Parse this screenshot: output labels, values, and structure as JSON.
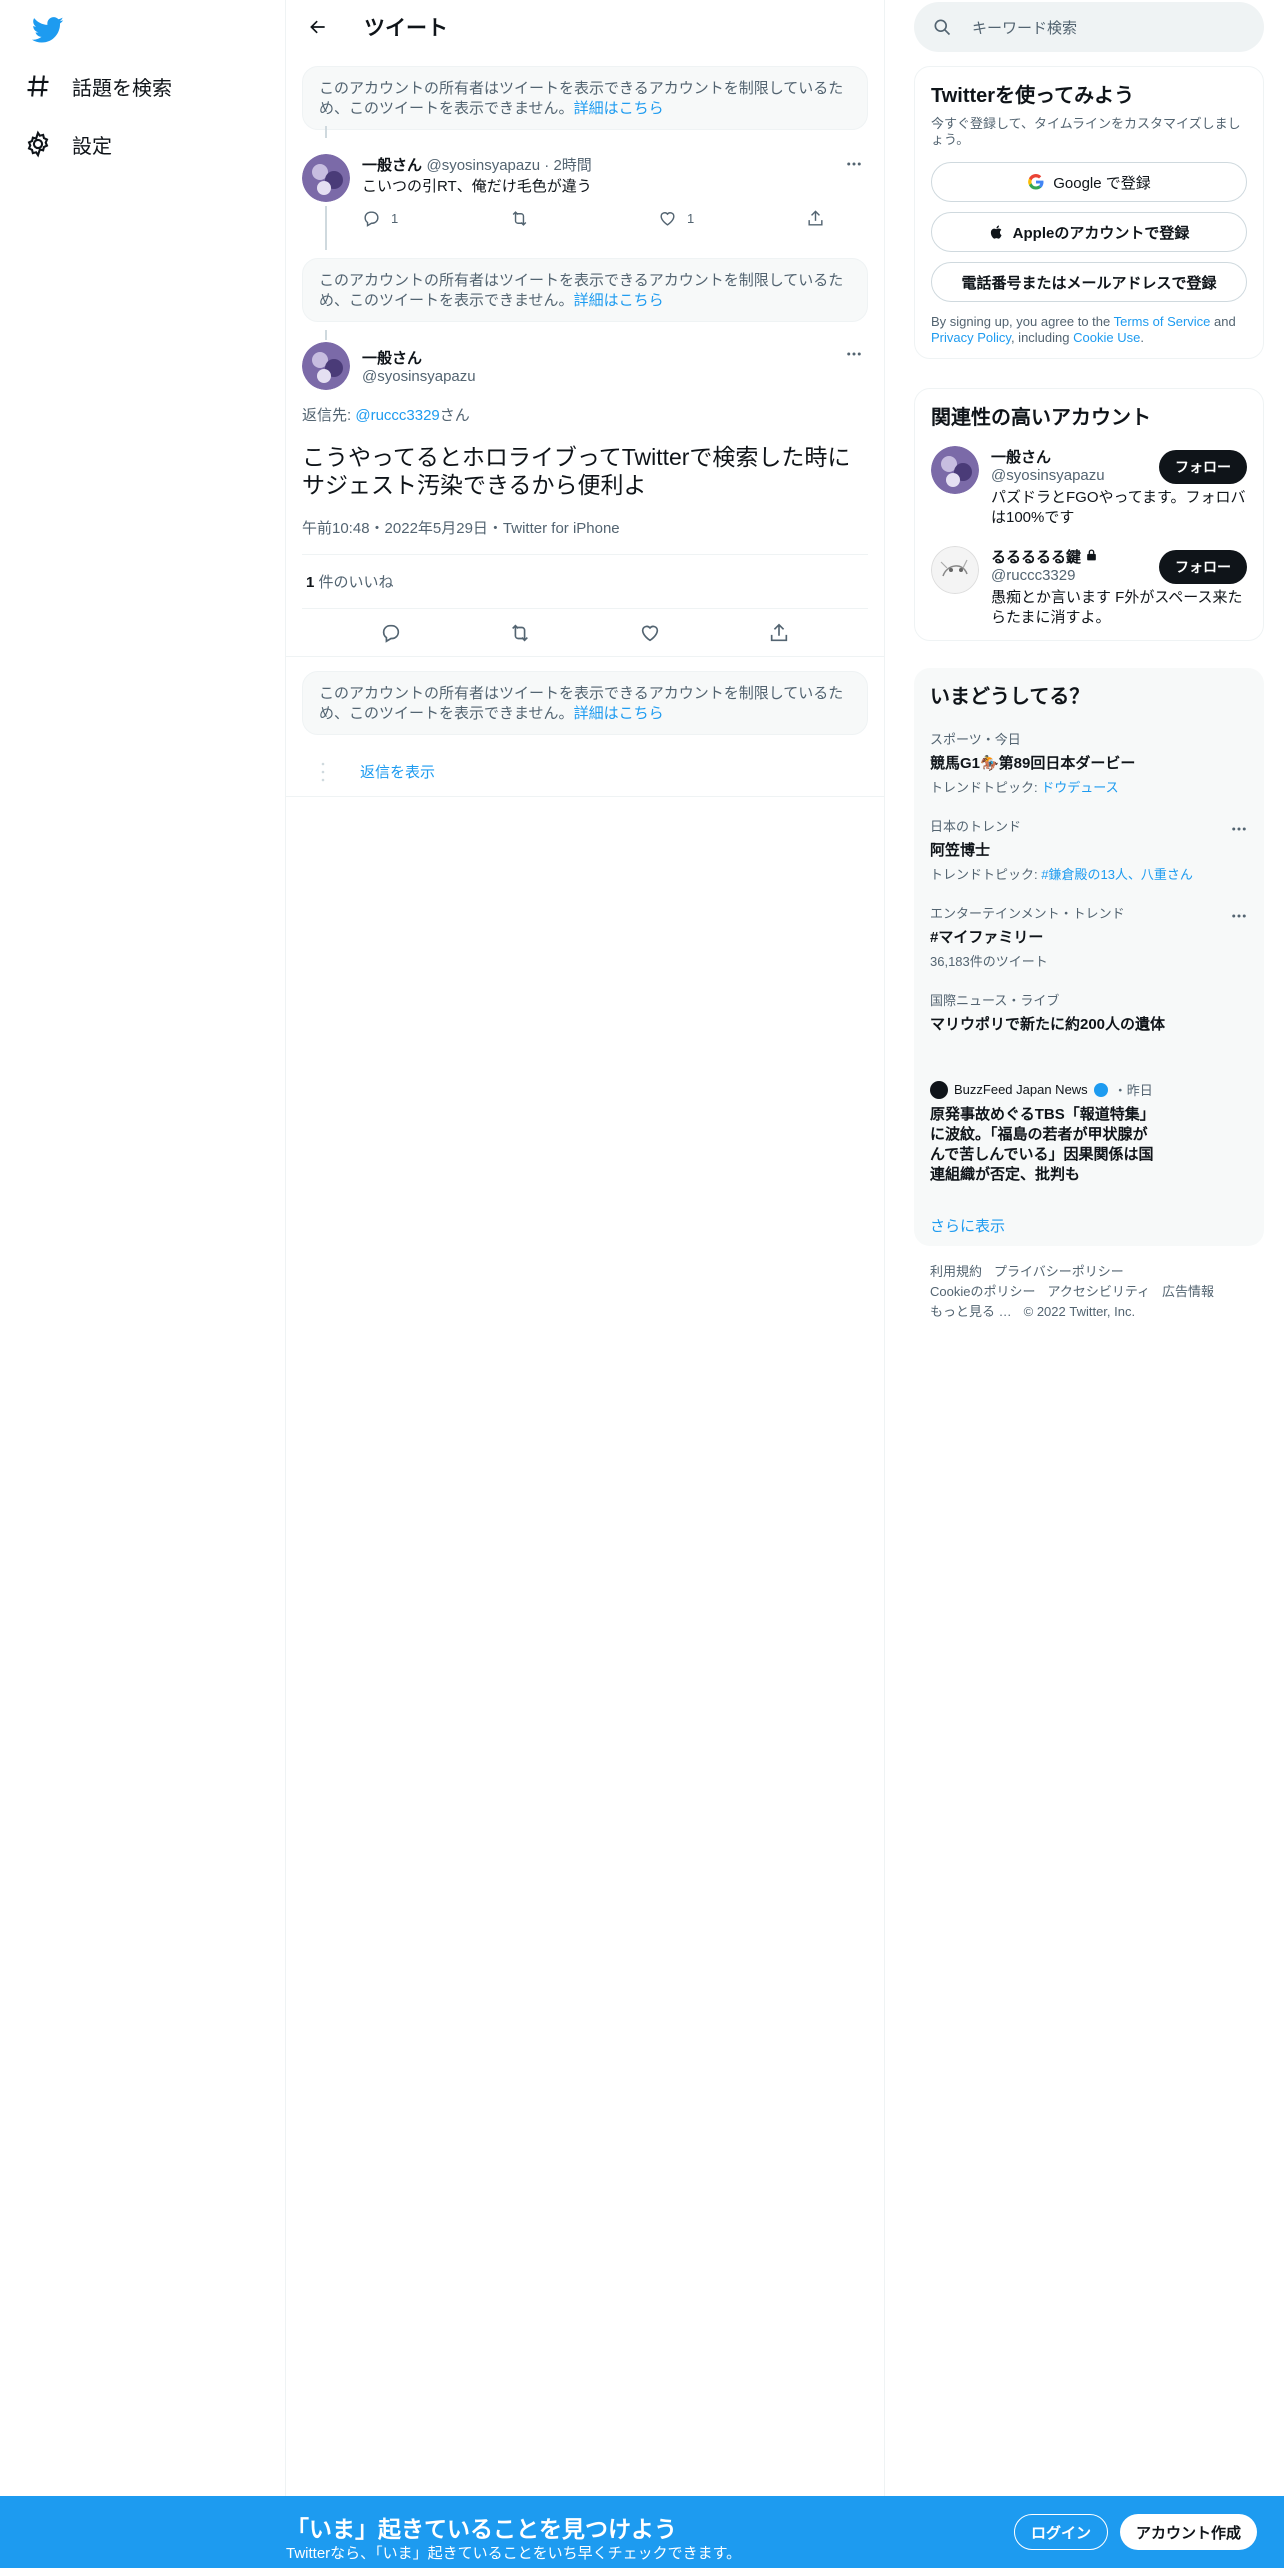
{
  "sidebar": {
    "items": [
      {
        "label": "話題を検索"
      },
      {
        "label": "設定"
      }
    ]
  },
  "header": {
    "title": "ツイート"
  },
  "notices": {
    "text": "このアカウントの所有者はツイートを表示できるアカウントを制限しているため、このツイートを表示できません。",
    "link": "詳細はこちら"
  },
  "reply_tweet": {
    "name": "一般さん",
    "handle": "@syosinsyapazu",
    "time": "2時間",
    "text": "こいつの引RT、俺だけ毛色が違う",
    "reply_count": "1",
    "like_count": "1"
  },
  "focus_tweet": {
    "name": "一般さん",
    "handle": "@syosinsyapazu",
    "reply_to_label": "返信先: ",
    "reply_to_handle": "@ruccc3329",
    "reply_to_suffix": "さん",
    "text": "こうやってるとホロライブってTwitterで検索した時にサジェスト汚染できるから便利よ",
    "meta": "午前10:48・2022年5月29日・Twitter for iPhone",
    "likes_count": "1",
    "likes_label": " 件のいいね"
  },
  "show_replies": "返信を表示",
  "search": {
    "placeholder": "キーワード検索"
  },
  "signup": {
    "title": "Twitterを使ってみよう",
    "subtitle": "今すぐ登録して、タイムラインをカスタマイズしましょう。",
    "google": "Google で登録",
    "apple": "Appleのアカウントで登録",
    "phone": "電話番号またはメールアドレスで登録",
    "legal_1": "By signing up, you agree to the ",
    "terms": "Terms of Service",
    "legal_2": " and ",
    "privacy": "Privacy Policy",
    "legal_3": ", including ",
    "cookie": "Cookie Use",
    "legal_4": "."
  },
  "who": {
    "title": "関連性の高いアカウント",
    "follow_label": "フォロー",
    "accounts": [
      {
        "name": "一般さん",
        "handle": "@syosinsyapazu",
        "bio": "パズドラとFGOやってます。フォロバは100%です"
      },
      {
        "name": "るるるるる鍵",
        "handle": "@ruccc3329",
        "bio": "愚痴とか言います F外がスペース来たらたまに消すよ。"
      }
    ]
  },
  "trends": {
    "title": "いまどうしてる？",
    "items": [
      {
        "context": "スポーツ・今日",
        "title": "競馬G1🏇第89回日本ダービー",
        "topic_label": "トレンドトピック: ",
        "topic": "ドウデュース"
      },
      {
        "context": "日本のトレンド",
        "title": "阿笠博士",
        "topic_label": "トレンドトピック: ",
        "topic": "#鎌倉殿の13人、八重さん"
      },
      {
        "context": "エンターテインメント・トレンド",
        "title": "#マイファミリー",
        "tweets": "36,183件のツイート"
      },
      {
        "context": "国際ニュース・ライブ",
        "title": "マリウポリで新たに約200人の遺体"
      }
    ],
    "news": {
      "source": "BuzzFeed Japan News",
      "time": "・昨日",
      "headline": "原発事故めぐるTBS「報道特集」に波紋。「福島の若者が甲状腺がんで苦しんでいる」因果関係は国連組織が否定、批判も"
    },
    "show_more": "さらに表示"
  },
  "footer": {
    "links": [
      "利用規約",
      "プライバシーポリシー",
      "Cookieのポリシー",
      "アクセシビリティ",
      "広告情報",
      "もっと見る …",
      "© 2022 Twitter, Inc."
    ]
  },
  "bottom_bar": {
    "title": "「いま」起きていることを見つけよう",
    "subtitle": "Twitterなら、「いま」起きていることをいち早くチェックできます。",
    "login": "ログイン",
    "signup": "アカウント作成"
  },
  "colors": {
    "accent": "#1d9bf0",
    "text": "#0f1419",
    "muted": "#536471"
  }
}
